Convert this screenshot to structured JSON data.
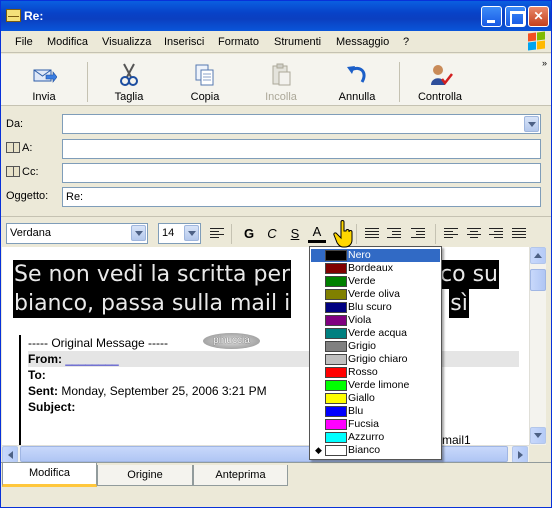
{
  "window": {
    "title": "Re:"
  },
  "menu": [
    "File",
    "Modifica",
    "Visualizza",
    "Inserisci",
    "Formato",
    "Strumenti",
    "Messaggio",
    "?"
  ],
  "toolbar": {
    "send": "Invia",
    "cut": "Taglia",
    "copy": "Copia",
    "paste": "Incolla",
    "undo": "Annulla",
    "check": "Controlla",
    "more": "»"
  },
  "fields": {
    "from_label": "Da:",
    "from_value": "",
    "to_label": "A:",
    "to_value": "",
    "cc_label": "Cc:",
    "cc_value": "",
    "subject_label": "Oggetto:",
    "subject_value": "Re:"
  },
  "format": {
    "font": "Verdana",
    "size": "14",
    "bold": "G",
    "italic": "C",
    "underline": "S",
    "fontcolor": "A"
  },
  "body": {
    "line1": "Se non vedi la scritta per",
    "line1_tail": "co su",
    "line2": "bianco, passa sulla mail i",
    "line2_tail": "sì",
    "original": "----- Original Message -----",
    "nick": "pinuccia",
    "from_label": "From:",
    "from_value": "________",
    "to_label": "To:",
    "sent_label": "Sent:",
    "sent_value": " Monday, September 25, 2006 3:21 PM",
    "subject_label": "Subject:",
    "tail": "mail1"
  },
  "colors": [
    {
      "name": "Nero",
      "hex": "#000000",
      "selected": true,
      "checked": false
    },
    {
      "name": "Bordeaux",
      "hex": "#800000",
      "selected": false,
      "checked": false
    },
    {
      "name": "Verde",
      "hex": "#008000",
      "selected": false,
      "checked": false
    },
    {
      "name": "Verde oliva",
      "hex": "#808000",
      "selected": false,
      "checked": false
    },
    {
      "name": "Blu scuro",
      "hex": "#000080",
      "selected": false,
      "checked": false
    },
    {
      "name": "Viola",
      "hex": "#800080",
      "selected": false,
      "checked": false
    },
    {
      "name": "Verde acqua",
      "hex": "#008080",
      "selected": false,
      "checked": false
    },
    {
      "name": "Grigio",
      "hex": "#808080",
      "selected": false,
      "checked": false
    },
    {
      "name": "Grigio chiaro",
      "hex": "#c0c0c0",
      "selected": false,
      "checked": false
    },
    {
      "name": "Rosso",
      "hex": "#ff0000",
      "selected": false,
      "checked": false
    },
    {
      "name": "Verde limone",
      "hex": "#00ff00",
      "selected": false,
      "checked": false
    },
    {
      "name": "Giallo",
      "hex": "#ffff00",
      "selected": false,
      "checked": false
    },
    {
      "name": "Blu",
      "hex": "#0000ff",
      "selected": false,
      "checked": false
    },
    {
      "name": "Fucsia",
      "hex": "#ff00ff",
      "selected": false,
      "checked": false
    },
    {
      "name": "Azzurro",
      "hex": "#00ffff",
      "selected": false,
      "checked": false
    },
    {
      "name": "Bianco",
      "hex": "#ffffff",
      "selected": false,
      "checked": true
    }
  ],
  "tabs": [
    {
      "label": "Modifica",
      "active": true
    },
    {
      "label": "Origine",
      "active": false
    },
    {
      "label": "Anteprima",
      "active": false
    }
  ],
  "accent": "#0a56da",
  "selection_color": "#316ac5"
}
